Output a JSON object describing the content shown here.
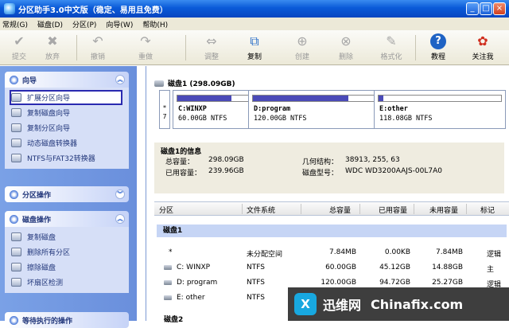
{
  "window": {
    "title": "分区助手3.0中文版（稳定、易用且免费）",
    "minimize": "_",
    "maximize": "□",
    "close": "×"
  },
  "menu": [
    "常规(G)",
    "磁盘(D)",
    "分区(P)",
    "向导(W)",
    "帮助(H)"
  ],
  "toolbar": [
    {
      "label": "提交",
      "icon": "✔"
    },
    {
      "label": "放弃",
      "icon": "✖"
    },
    {
      "label": "撤销",
      "icon": "↶"
    },
    {
      "label": "重做",
      "icon": "↷"
    },
    {
      "label": "调整",
      "icon": "⇔"
    },
    {
      "label": "复制",
      "icon": "⧉"
    },
    {
      "label": "创建",
      "icon": "⊕"
    },
    {
      "label": "删除",
      "icon": "⊗"
    },
    {
      "label": "格式化",
      "icon": "✎"
    },
    {
      "label": "教程",
      "icon": "?"
    },
    {
      "label": "关注我",
      "icon": "✿"
    }
  ],
  "sidebar": {
    "wizard": {
      "title": "向导",
      "items": [
        "扩展分区向导",
        "复制磁盘向导",
        "复制分区向导",
        "动态磁盘转换器",
        "NTFS与FAT32转换器"
      ]
    },
    "partition_ops": {
      "title": "分区操作"
    },
    "disk_ops": {
      "title": "磁盘操作",
      "items": [
        "复制磁盘",
        "删除所有分区",
        "擦除磁盘",
        "坏扇区检测"
      ]
    },
    "pending": {
      "title": "等待执行的操作"
    }
  },
  "disk": {
    "header": "磁盘1 (298.09GB)",
    "unalloc_label": "*",
    "unalloc_size": "7",
    "partitions": [
      {
        "name": "C:WINXP",
        "size": "60.00GB NTFS",
        "used_fraction": 0.75
      },
      {
        "name": "D:program",
        "size": "120.00GB NTFS",
        "used_fraction": 0.79
      },
      {
        "name": "E:other",
        "size": "118.08GB NTFS",
        "used_fraction": 0.04
      }
    ]
  },
  "info": {
    "title": "磁盘1的信息",
    "total_label": "总容量：",
    "total": "298.09GB",
    "used_label": "已用容量：",
    "used": "239.96GB",
    "geometry_label": "几何结构：",
    "geometry": "38913, 255, 63",
    "model_label": "磁盘型号：",
    "model": "WDC WD3200AAJS-00L7A0"
  },
  "table": {
    "columns": [
      "分区",
      "文件系统",
      "总容量",
      "已用容量",
      "未用容量",
      "标记"
    ],
    "disk1": "磁盘1",
    "disk2": "磁盘2",
    "rows": [
      {
        "partition": "*",
        "fs": "未分配空间",
        "total": "7.84MB",
        "used": "0.00KB",
        "free": "7.84MB",
        "flag": "逻辑"
      },
      {
        "partition": "C: WINXP",
        "fs": "NTFS",
        "total": "60.00GB",
        "used": "45.12GB",
        "free": "14.88GB",
        "flag": "主"
      },
      {
        "partition": "D: program",
        "fs": "NTFS",
        "total": "120.00GB",
        "used": "94.72GB",
        "free": "25.27GB",
        "flag": "逻辑"
      },
      {
        "partition": "E: other",
        "fs": "NTFS",
        "total": "",
        "used": "",
        "free": "",
        "flag": ""
      }
    ]
  },
  "watermark": {
    "logo": "X",
    "cn": "迅维网",
    "en": "Chinafix.com"
  }
}
